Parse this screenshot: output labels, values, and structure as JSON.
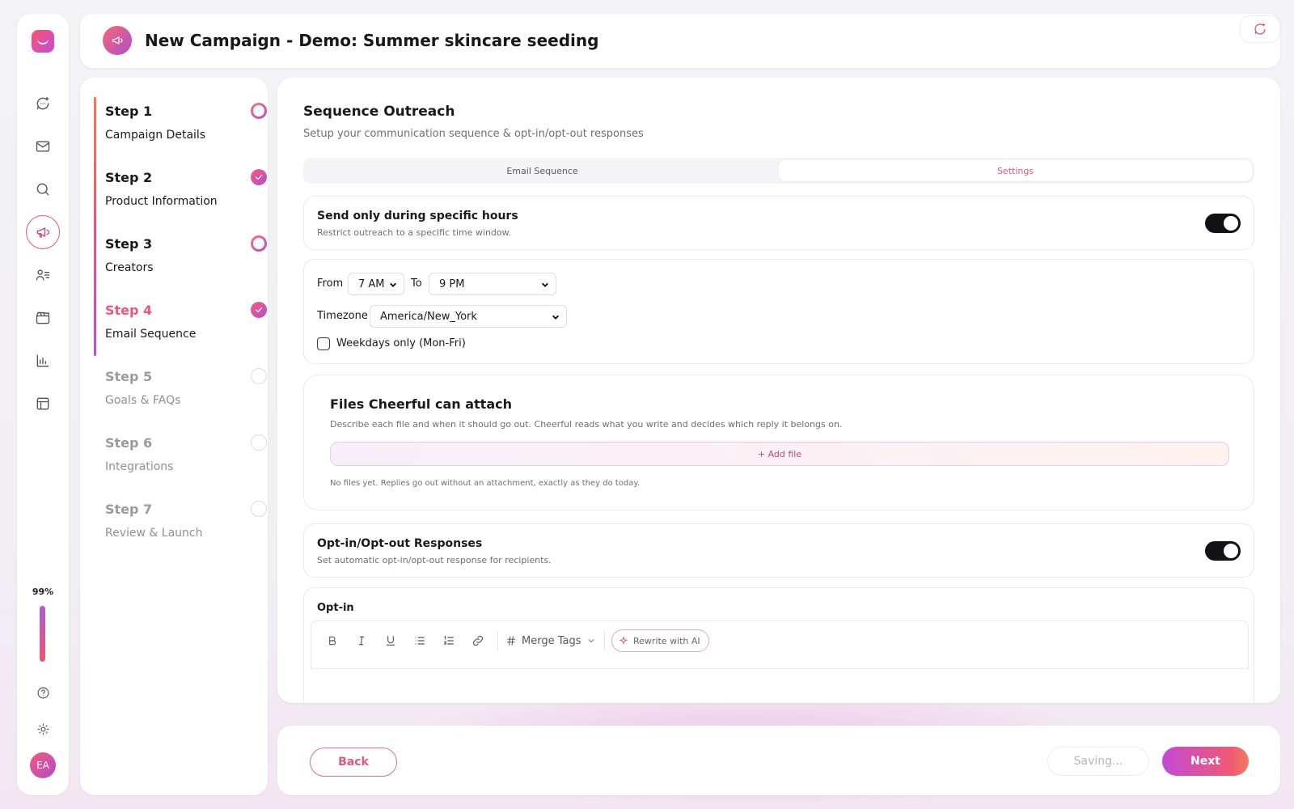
{
  "header": {
    "title": "New Campaign - Demo: Summer skincare seeding"
  },
  "rail": {
    "progress_label": "99%",
    "progress_value": 0.99,
    "avatar_initials": "EA",
    "icons": [
      "app-logo",
      "chat-sparkle-icon",
      "mail-icon",
      "search-icon",
      "megaphone-icon",
      "users-list-icon",
      "clapperboard-icon",
      "bar-chart-icon",
      "table-icon",
      "help-icon",
      "sun-icon"
    ]
  },
  "steps": [
    {
      "title": "Step 1",
      "label": "Campaign Details",
      "state": "ring"
    },
    {
      "title": "Step 2",
      "label": "Product Information",
      "state": "done"
    },
    {
      "title": "Step 3",
      "label": "Creators",
      "state": "ring"
    },
    {
      "title": "Step 4",
      "label": "Email Sequence",
      "state": "current"
    },
    {
      "title": "Step 5",
      "label": "Goals & FAQs",
      "state": "inactive"
    },
    {
      "title": "Step 6",
      "label": "Integrations",
      "state": "inactive"
    },
    {
      "title": "Step 7",
      "label": "Review & Launch",
      "state": "inactive"
    }
  ],
  "main": {
    "title": "Sequence Outreach",
    "subtitle": "Setup your communication sequence & opt-in/opt-out responses",
    "tabs": [
      {
        "label": "Email Sequence",
        "active": false
      },
      {
        "label": "Settings",
        "active": true
      }
    ],
    "hours": {
      "title": "Send only during specific hours",
      "desc": "Restrict outreach to a specific time window.",
      "enabled": true
    },
    "window": {
      "from_label": "From",
      "from_value": "7 AM",
      "to_label": "To",
      "to_value": "9 PM",
      "timezone_label": "Timezone",
      "timezone_value": "America/New_York",
      "weekdays_label": "Weekdays only (Mon-Fri)",
      "weekdays_checked": false
    },
    "files": {
      "title": "Files Cheerful can attach",
      "desc": "Describe each file and when it should go out. Cheerful reads what you write and decides which reply it belongs on.",
      "add_label": "+ Add file",
      "empty_note": "No files yet. Replies go out without an attachment, exactly as they do today."
    },
    "optinout": {
      "title": "Opt-in/Opt-out Responses",
      "desc": "Set automatic opt-in/opt-out response for recipients.",
      "enabled": true
    },
    "optin": {
      "label": "Opt-in",
      "merge_tags_label": "Merge Tags",
      "rewrite_label": "Rewrite with AI"
    }
  },
  "footer": {
    "back_label": "Back",
    "saving_label": "Saving...",
    "next_label": "Next"
  },
  "colors": {
    "accent": "#e5547b",
    "accent_purple": "#b14ed2",
    "toggle_on": "#121216"
  }
}
